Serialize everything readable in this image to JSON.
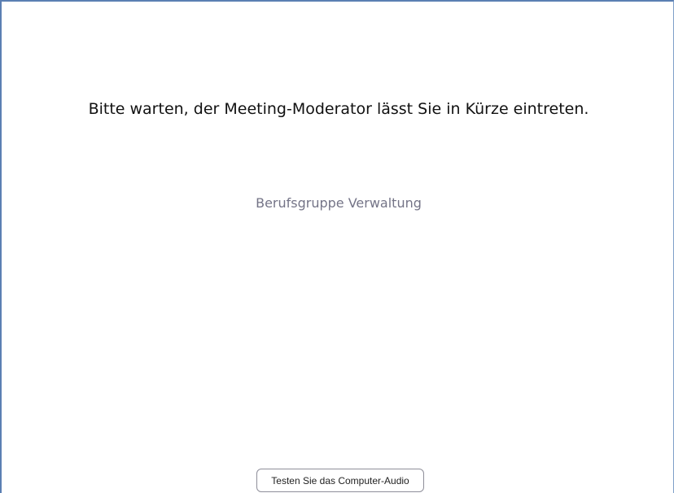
{
  "waiting_room": {
    "message": "Bitte warten, der Meeting-Moderator lässt Sie in Kürze eintreten.",
    "meeting_topic": "Berufsgruppe Verwaltung",
    "test_audio_label": "Testen Sie das Computer-Audio"
  },
  "colors": {
    "window_border": "#5b7fb3",
    "topic_text": "#747487"
  }
}
